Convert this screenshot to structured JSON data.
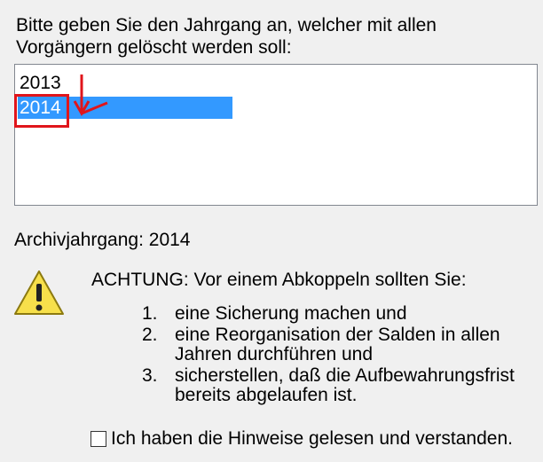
{
  "prompt": {
    "line1": "Bitte geben Sie den Jahrgang an, welcher mit allen",
    "line2": "Vorgängern gelöscht werden soll:"
  },
  "years": [
    {
      "label": "2013",
      "selected": false
    },
    {
      "label": "2014",
      "selected": true
    }
  ],
  "archive": {
    "label": "Archivjahrgang:",
    "value": "2014"
  },
  "warning": {
    "icon": "warning-icon",
    "title": "ACHTUNG: Vor einem Abkoppeln sollten Sie:",
    "steps": [
      {
        "num": "1.",
        "lines": [
          "eine Sicherung machen und"
        ]
      },
      {
        "num": "2.",
        "lines": [
          "eine Reorganisation der Salden in allen",
          "Jahren durchführen und"
        ]
      },
      {
        "num": "3.",
        "lines": [
          "sicherstellen, daß die Aufbewahrungsfrist",
          "bereits abgelaufen ist."
        ]
      }
    ]
  },
  "consent": {
    "label": "Ich haben die Hinweise gelesen und verstanden.",
    "checked": false
  },
  "colors": {
    "selection": "#3399ff",
    "annotation": "#e0151b",
    "background": "#f0f0f0"
  }
}
